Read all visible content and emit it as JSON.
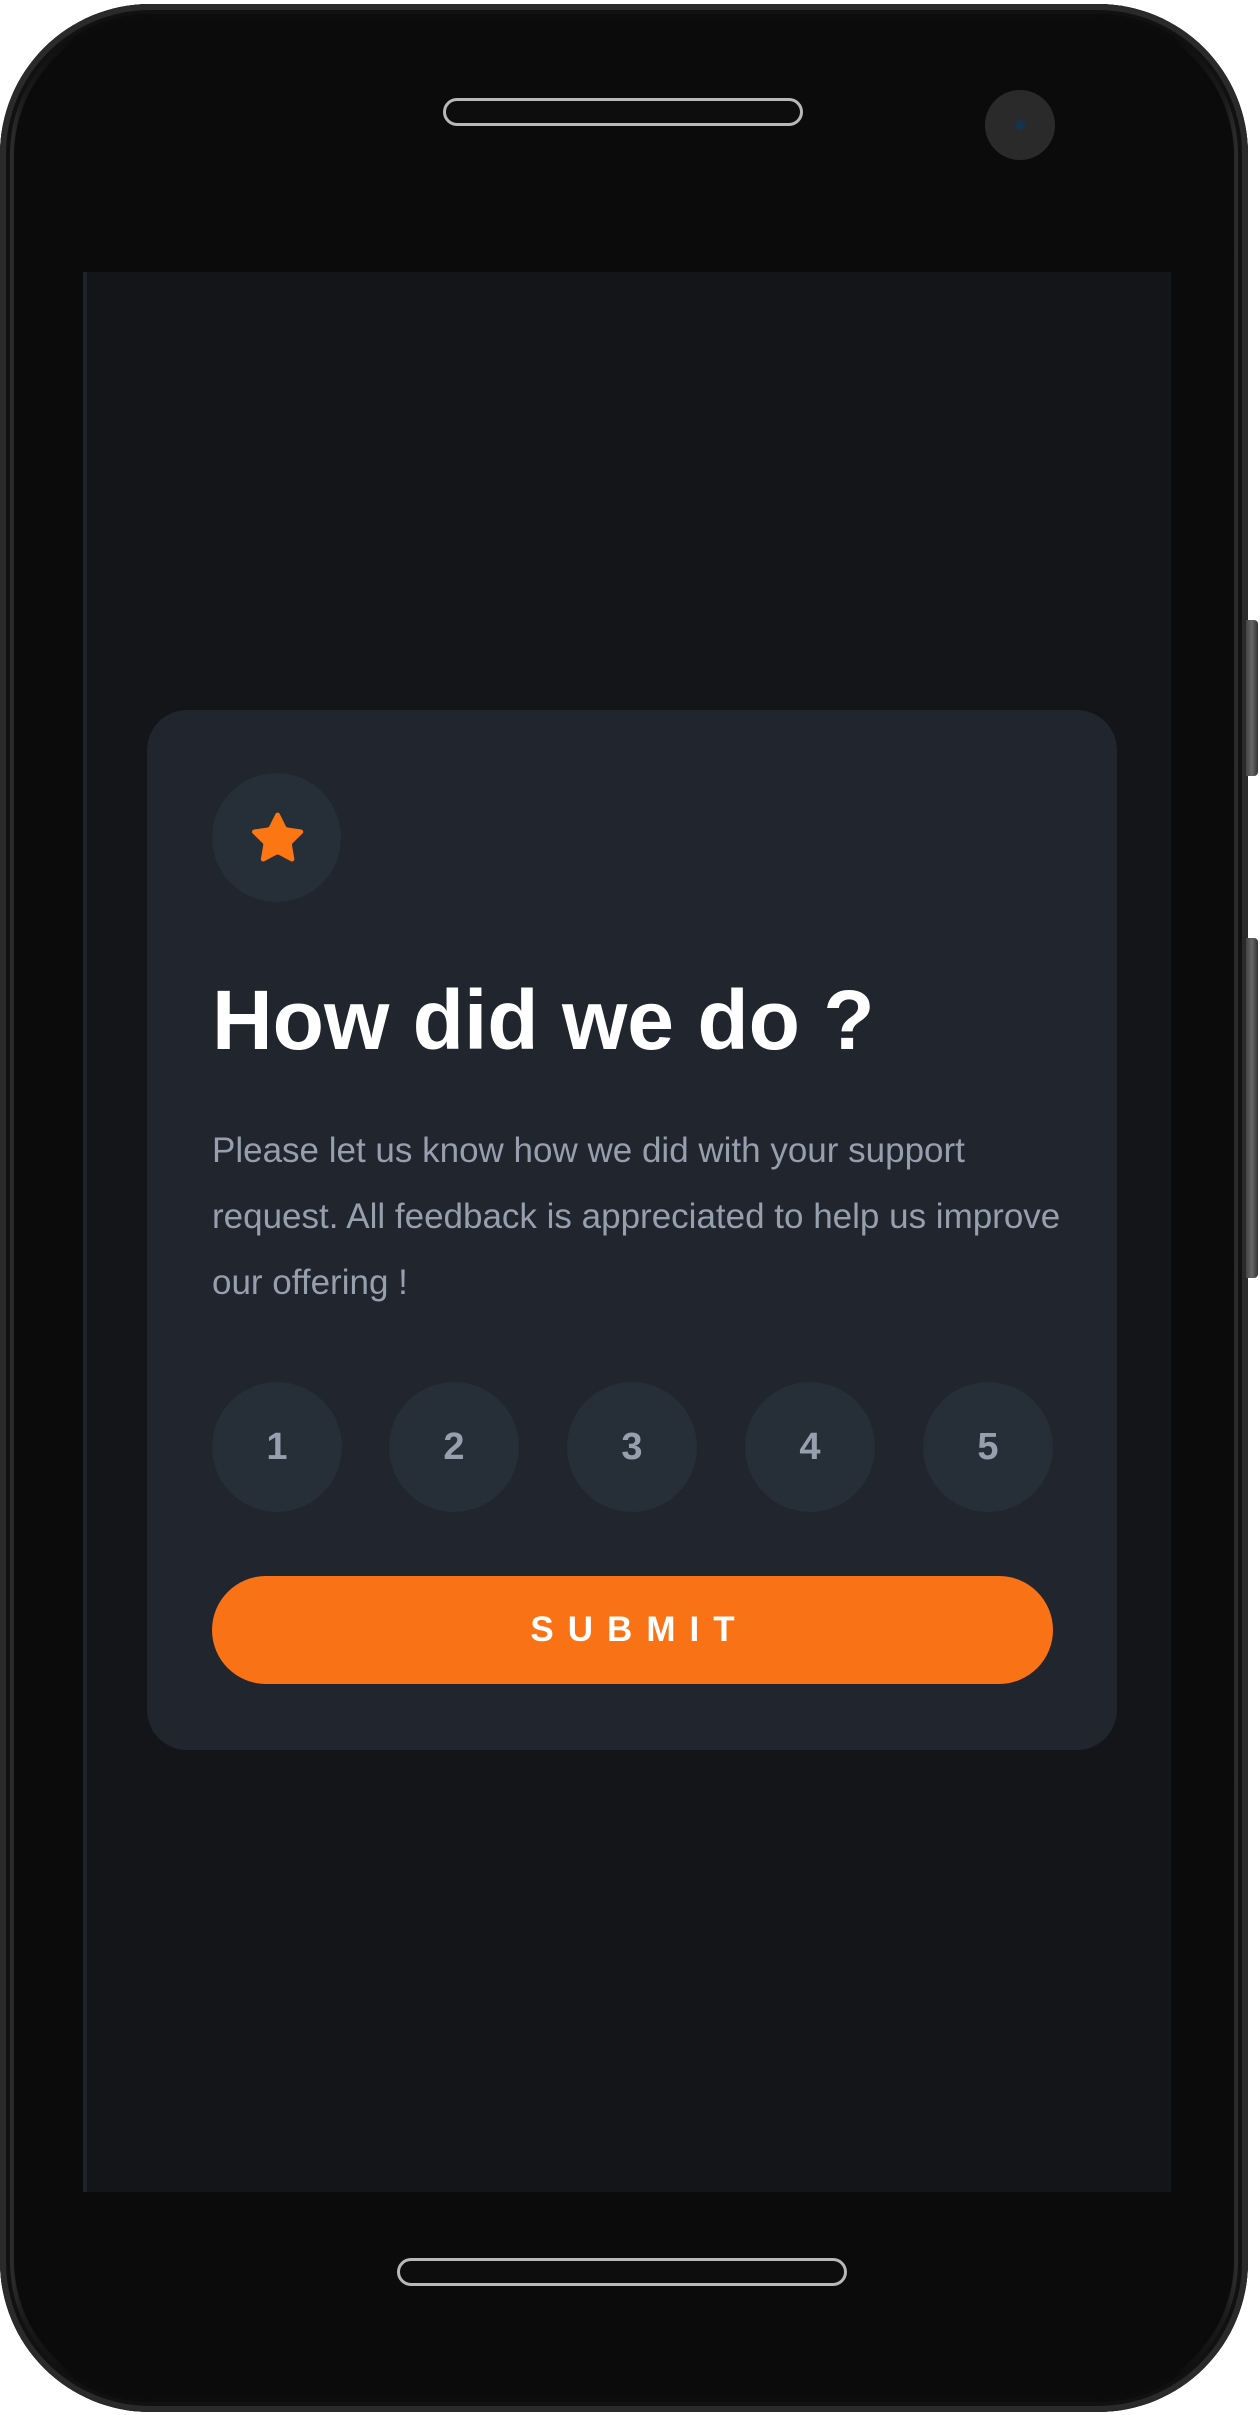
{
  "card": {
    "title": "How did we do ?",
    "description": "Please let us know how we did with your support request. All feedback is appreciated to help us improve our offering !",
    "ratings": [
      "1",
      "2",
      "3",
      "4",
      "5"
    ],
    "submit_label": "SUBMIT",
    "icon": "star-icon"
  },
  "colors": {
    "accent": "#f97316",
    "card_background": "#20252e",
    "screen_background": "#131518",
    "muted_text": "#969fad",
    "circle_background": "#262e38"
  }
}
